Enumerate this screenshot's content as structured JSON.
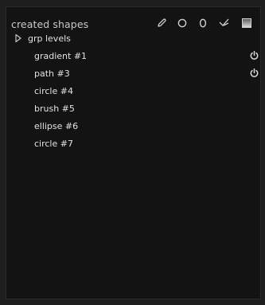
{
  "panel": {
    "title": "created shapes",
    "tools": [
      {
        "icon": "pencil-icon"
      },
      {
        "icon": "circle-icon"
      },
      {
        "icon": "ellipse-icon"
      },
      {
        "icon": "path-icon"
      },
      {
        "icon": "gradient-icon"
      }
    ]
  },
  "shapes": [
    {
      "label": "grp levels",
      "type": "group",
      "expander": "triangle-right-icon"
    },
    {
      "label": "gradient #1",
      "type": "item",
      "toggle": "power-icon"
    },
    {
      "label": "path #3",
      "type": "item",
      "toggle": "power-icon"
    },
    {
      "label": "circle #4",
      "type": "item"
    },
    {
      "label": "brush #5",
      "type": "item"
    },
    {
      "label": "ellipse #6",
      "type": "item"
    },
    {
      "label": "circle #7",
      "type": "item"
    }
  ]
}
